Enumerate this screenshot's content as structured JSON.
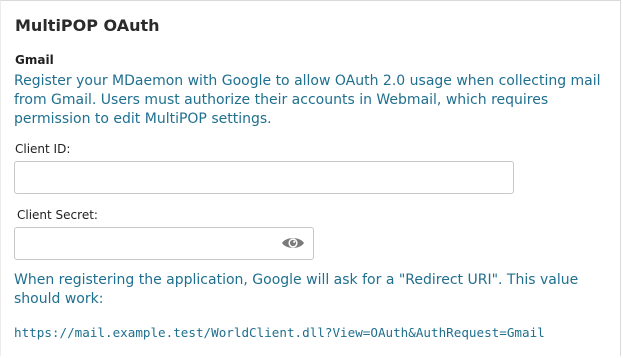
{
  "header": {
    "title": "MultiPOP OAuth"
  },
  "gmail": {
    "heading": "Gmail",
    "description": "Register your MDaemon with Google to allow OAuth 2.0 usage when collecting mail from Gmail. Users must authorize their accounts in Webmail, which requires permission to edit MultiPOP settings.",
    "client_id": {
      "label": "Client ID:",
      "value": ""
    },
    "client_secret": {
      "label": "Client Secret:",
      "value": "",
      "toggle_icon": "eye-icon"
    },
    "redirect_hint": "When registering the application, Google will ask for a \"Redirect URI\". This value should work:",
    "redirect_uri": "https://mail.example.test/WorldClient.dll?View=OAuth&AuthRequest=Gmail"
  },
  "colors": {
    "accent_text": "#1f6f8f",
    "heading_text": "#2b2b2b",
    "input_border": "#c7c7c7",
    "icon": "#7a7a7a"
  }
}
